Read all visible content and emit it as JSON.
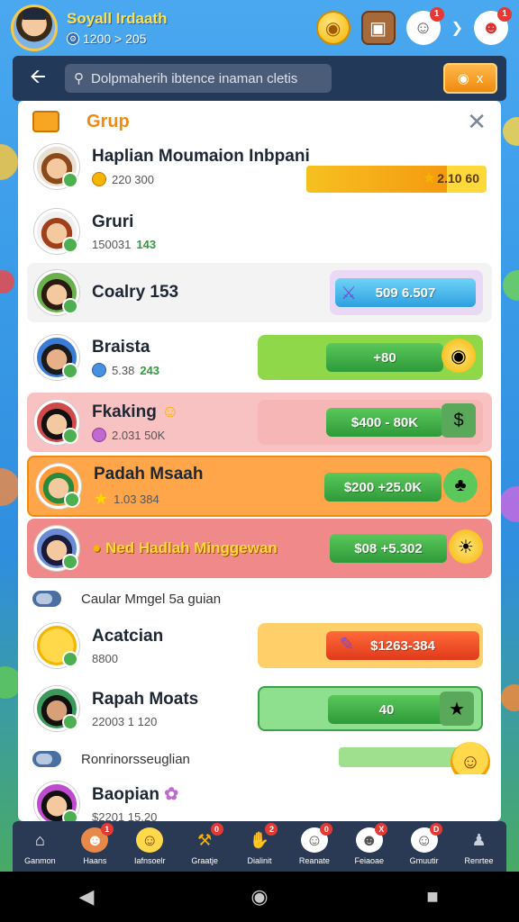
{
  "header": {
    "player_name": "Soyall Irdaath",
    "player_sub": "1200 > 205",
    "icons": [
      "coin-icon",
      "chest-icon",
      "ghost-icon",
      "face-icon"
    ],
    "badges": [
      "1",
      "1"
    ]
  },
  "search": {
    "placeholder": "Dolpmaherih ibtence inaman cletis",
    "action_label": "x"
  },
  "panel": {
    "title": "Grup",
    "rows": [
      {
        "name": "Haplian Moumaion Inbpani",
        "sub": "220 300",
        "reward": "2.10 60",
        "progress_pct": 78
      },
      {
        "name": "Gruri",
        "sub": "150031",
        "sub_green": "143"
      },
      {
        "name": "Coalry 153",
        "reward": "509 6.507"
      },
      {
        "name": "Braista",
        "sub": "5.38",
        "sub_green": "243",
        "reward": "+80"
      },
      {
        "name": "Fkaking",
        "sub": "2.031 50K",
        "reward": "$400 - 80K"
      },
      {
        "name": "Padah Msaah",
        "sub": "1.03 384",
        "reward": "$200 +25.0K"
      },
      {
        "name": "Ned Hadlah Minggewan",
        "reward": "$08 +5.302"
      }
    ],
    "section1": "Caular Mmgel 5a guian",
    "rows2": [
      {
        "name": "Acatcian",
        "sub": "8800",
        "reward": "$1263-384"
      },
      {
        "name": "Rapah Moats",
        "sub": "22003 1 120",
        "reward": "40"
      }
    ],
    "section2": "Ronrinorsseuglian",
    "rows3": [
      {
        "name": "Baopian",
        "sub": "$2201 15.20"
      }
    ]
  },
  "bottom_nav": [
    {
      "label": "Ganmon",
      "icon": "home-icon"
    },
    {
      "label": "Haans",
      "icon": "avatar-icon",
      "badge": "1"
    },
    {
      "label": "Iafnsoelr",
      "icon": "smiley-icon"
    },
    {
      "label": "Graatje",
      "icon": "tools-icon",
      "badge": "0"
    },
    {
      "label": "Dialinit",
      "icon": "hand-icon",
      "badge": "2"
    },
    {
      "label": "Reanate",
      "icon": "ghost-icon",
      "badge": "0"
    },
    {
      "label": "Feiaoae",
      "icon": "ghost2-icon",
      "badge": "X"
    },
    {
      "label": "Gmuutir",
      "icon": "ghost3-icon",
      "badge": "D"
    },
    {
      "label": "Renrtee",
      "icon": "person-icon"
    }
  ],
  "colors": {
    "accent": "#f08a10",
    "panel_bg": "#ffffff",
    "nav_bg": "#2a3a55"
  }
}
